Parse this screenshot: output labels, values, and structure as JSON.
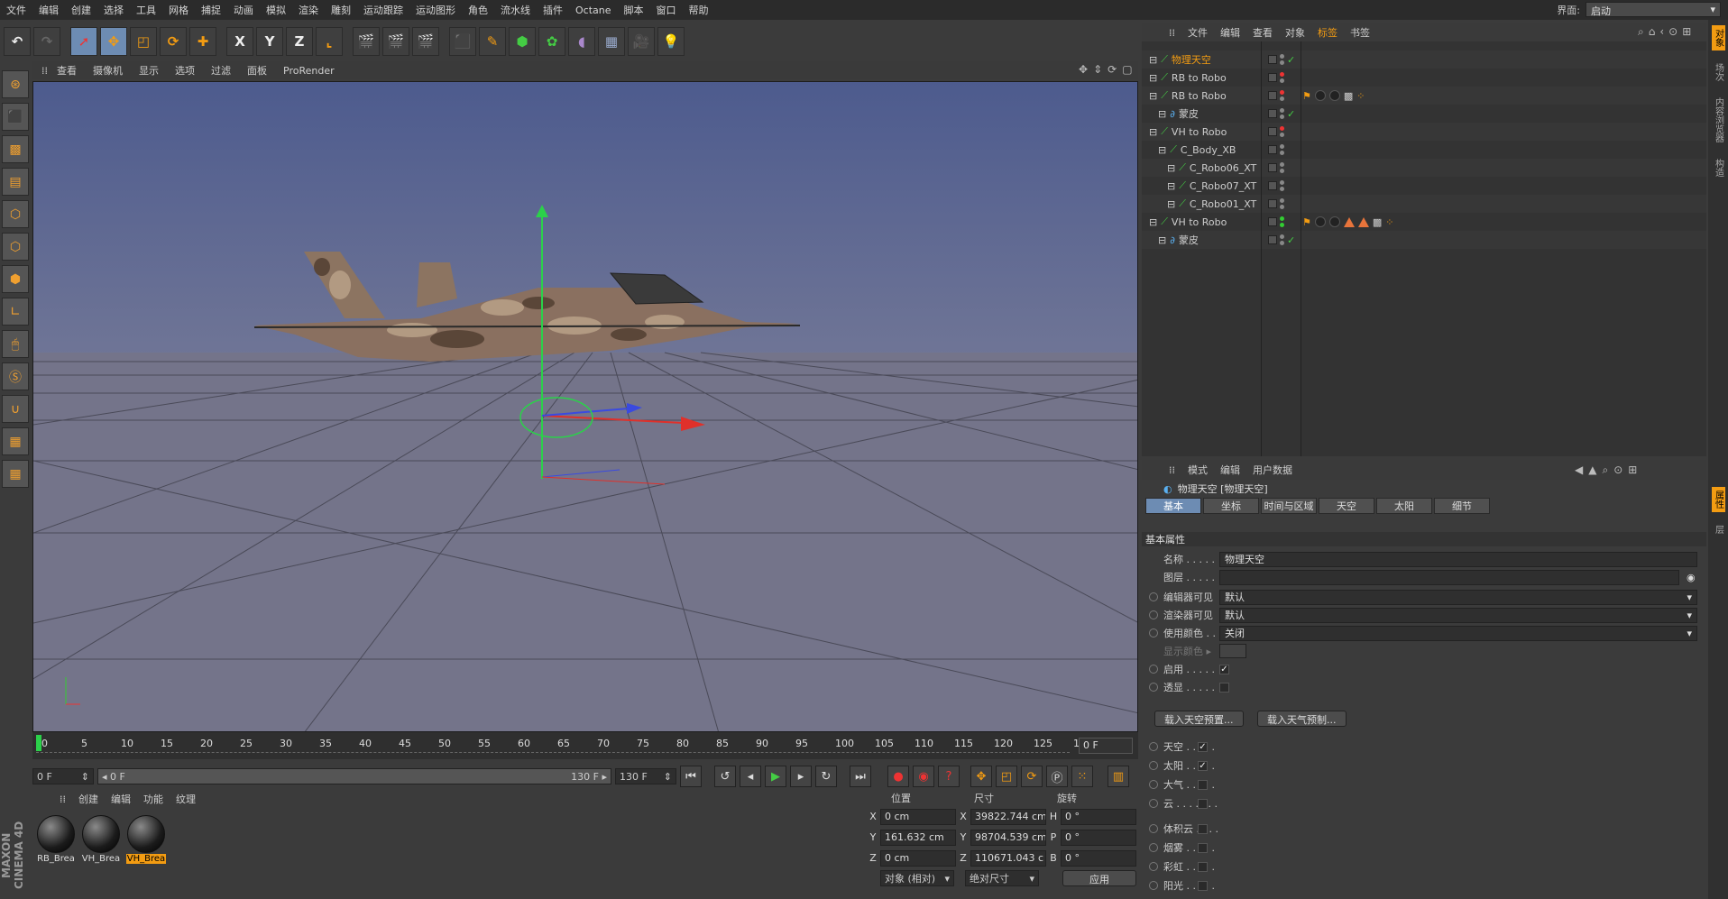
{
  "menubar": {
    "items": [
      "文件",
      "编辑",
      "创建",
      "选择",
      "工具",
      "网格",
      "捕捉",
      "动画",
      "模拟",
      "渲染",
      "雕刻",
      "运动跟踪",
      "运动图形",
      "角色",
      "流水线",
      "插件",
      "Octane",
      "脚本",
      "窗口",
      "帮助"
    ],
    "layout_label": "界面:",
    "layout_value": "启动"
  },
  "toolbar": {
    "axis_x": "X",
    "axis_y": "Y",
    "axis_z": "Z"
  },
  "viewport": {
    "menu": [
      "查看",
      "摄像机",
      "显示",
      "选项",
      "过滤",
      "面板",
      "ProRender"
    ]
  },
  "timeline": {
    "ticks": [
      "0",
      "5",
      "10",
      "15",
      "20",
      "25",
      "30",
      "35",
      "40",
      "45",
      "50",
      "55",
      "60",
      "65",
      "70",
      "75",
      "80",
      "85",
      "90",
      "95",
      "100",
      "105",
      "110",
      "115",
      "120",
      "125",
      "130"
    ],
    "current_frame": "0 F"
  },
  "transport": {
    "start_field": "0 F",
    "range_start": "◂ 0 F",
    "range_end": "130 F ▸",
    "end_field": "130 F"
  },
  "materials": {
    "menu": [
      "创建",
      "编辑",
      "功能",
      "纹理"
    ],
    "items": [
      {
        "label": "RB_Brea",
        "selected": false
      },
      {
        "label": "VH_Brea",
        "selected": false
      },
      {
        "label": "VH_Brea",
        "selected": true
      }
    ]
  },
  "coords": {
    "headers": [
      "位置",
      "尺寸",
      "旋转"
    ],
    "rows": [
      {
        "a": "X",
        "pos": "0 cm",
        "b": "X",
        "size": "39822.744 cm",
        "c": "H",
        "rot": "0 °"
      },
      {
        "a": "Y",
        "pos": "161.632 cm",
        "b": "Y",
        "size": "98704.539 cm",
        "c": "P",
        "rot": "0 °"
      },
      {
        "a": "Z",
        "pos": "0 cm",
        "b": "Z",
        "size": "110671.043 c",
        "c": "B",
        "rot": "0 °"
      }
    ],
    "mode_select": "对象 (相对)",
    "size_select": "绝对尺寸",
    "apply_button": "应用"
  },
  "objects": {
    "menu": [
      "文件",
      "编辑",
      "查看",
      "对象",
      "标签",
      "书签"
    ],
    "rows": [
      {
        "name": "物理天空",
        "selected": true,
        "indent": 0,
        "dot1": "#888",
        "dot2": "#888",
        "check": true,
        "tags": []
      },
      {
        "name": "RB to Robo",
        "selected": false,
        "indent": 0,
        "dot1": "#e33",
        "dot2": "#888",
        "check": false,
        "tags": []
      },
      {
        "name": "RB to Robo",
        "selected": false,
        "indent": 0,
        "dot1": "#e33",
        "dot2": "#888",
        "check": false,
        "tags": [
          "flag",
          "dot",
          "dot",
          "check",
          "orange"
        ]
      },
      {
        "name": "蒙皮",
        "selected": false,
        "indent": 1,
        "dot1": "#888",
        "dot2": "#888",
        "check": true,
        "tags": []
      },
      {
        "name": "VH to Robo",
        "selected": false,
        "indent": 0,
        "dot1": "#e33",
        "dot2": "#888",
        "check": false,
        "tags": []
      },
      {
        "name": "C_Body_XB",
        "selected": false,
        "indent": 1,
        "dot1": "#888",
        "dot2": "#888",
        "check": false,
        "tags": []
      },
      {
        "name": "C_Robo06_XT",
        "selected": false,
        "indent": 2,
        "dot1": "#888",
        "dot2": "#888",
        "check": false,
        "tags": []
      },
      {
        "name": "C_Robo07_XT",
        "selected": false,
        "indent": 2,
        "dot1": "#888",
        "dot2": "#888",
        "check": false,
        "tags": []
      },
      {
        "name": "C_Robo01_XT",
        "selected": false,
        "indent": 2,
        "dot1": "#888",
        "dot2": "#888",
        "check": false,
        "tags": []
      },
      {
        "name": "VH to Robo",
        "selected": false,
        "indent": 0,
        "dot1": "#3c3",
        "dot2": "#3c3",
        "check": false,
        "tags": [
          "flag",
          "dot",
          "dot",
          "tri",
          "tri",
          "check",
          "orange"
        ]
      },
      {
        "name": "蒙皮",
        "selected": false,
        "indent": 1,
        "dot1": "#888",
        "dot2": "#888",
        "check": true,
        "tags": []
      }
    ]
  },
  "attributes": {
    "menu": [
      "模式",
      "编辑",
      "用户数据"
    ],
    "title": "物理天空 [物理天空]",
    "tabs": [
      "基本",
      "坐标",
      "时间与区域",
      "天空",
      "太阳",
      "细节"
    ],
    "section": "基本属性",
    "name_label": "名称 . . . . .",
    "name_value": "物理天空",
    "layer_label": "图层 . . . . .",
    "editor_vis_label": "编辑器可见",
    "editor_vis_value": "默认",
    "render_vis_label": "渲染器可见",
    "render_vis_value": "默认",
    "use_color_label": "使用颜色 . .",
    "use_color_value": "关闭",
    "display_color_label": "显示颜色 ▸",
    "enable_label": "启用 . . . . .",
    "xray_label": "透显 . . . . .",
    "load_sky_preset": "载入天空预置...",
    "load_weather_preset": "载入天气预制...",
    "toggles": [
      {
        "label": "天空 . . . . .",
        "checked": true
      },
      {
        "label": "太阳 . . . . .",
        "checked": true
      },
      {
        "label": "大气 . . . . .",
        "checked": false
      },
      {
        "label": "云 . . . . . . .",
        "checked": false
      },
      {
        "label": "体积云 . . . .",
        "checked": false
      },
      {
        "label": "烟雾 . . . . .",
        "checked": false
      },
      {
        "label": "彩虹 . . . . .",
        "checked": false
      },
      {
        "label": "阳光 . . . . .",
        "checked": false
      }
    ]
  },
  "right_strip": {
    "tabs": [
      "对象",
      "场次",
      "内容浏览器",
      "构造",
      "属性",
      "层"
    ]
  },
  "brand": {
    "text": "MAXON CINEMA 4D"
  },
  "colors": {
    "accent": "#f39c12",
    "selection_blue": "#6d8cb3",
    "panel_bg": "#3b3b3b"
  }
}
